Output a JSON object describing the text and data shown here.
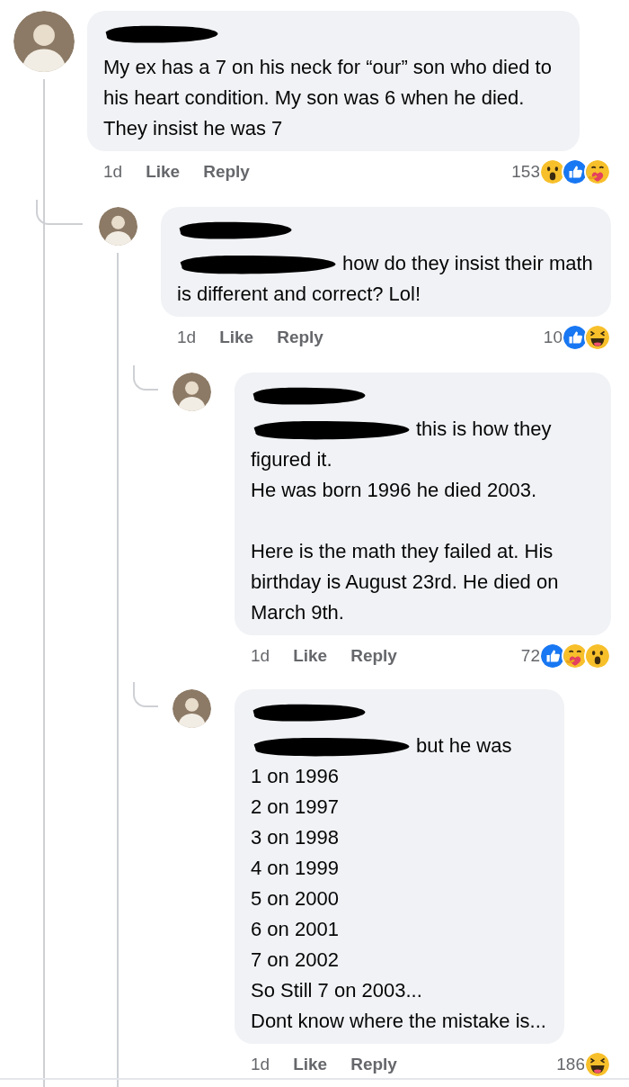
{
  "comments": [
    {
      "author_redacted": true,
      "text": "My ex has a 7 on his neck for “our” son who died to his heart condition. My son was 6 when he died. They insist he was 7",
      "time": "1d",
      "actions": [
        "Like",
        "Reply"
      ],
      "reaction_count": "153",
      "reactions": [
        {
          "kind": "wow"
        },
        {
          "kind": "like"
        },
        {
          "kind": "care"
        }
      ],
      "children": [
        {
          "author_redacted": true,
          "mention_redacted": true,
          "text": "how do they insist their math is different and correct? Lol!",
          "time": "1d",
          "actions": [
            "Like",
            "Reply"
          ],
          "reaction_count": "10",
          "reactions": [
            {
              "kind": "like"
            },
            {
              "kind": "haha"
            }
          ],
          "children": [
            {
              "author_redacted": true,
              "mention_redacted": true,
              "text": "this is how they figured it.\nHe was born 1996 he died 2003.\n\nHere is the math they failed at. His birthday is August 23rd. He died on March 9th.",
              "time": "1d",
              "actions": [
                "Like",
                "Reply"
              ],
              "reaction_count": "72",
              "reactions": [
                {
                  "kind": "like"
                },
                {
                  "kind": "care"
                },
                {
                  "kind": "wow"
                }
              ]
            },
            {
              "author_redacted": true,
              "mention_redacted": true,
              "text": "but he was\n1 on 1996\n2 on 1997\n3 on 1998\n4 on 1999\n5 on 2000\n6 on 2001\n7 on 2002\nSo Still 7 on 2003...\nDont know where the mistake is...",
              "time": "1d",
              "actions": [
                "Like",
                "Reply"
              ],
              "reaction_count": "186",
              "reactions": [
                {
                  "kind": "haha"
                }
              ]
            }
          ]
        }
      ]
    }
  ]
}
